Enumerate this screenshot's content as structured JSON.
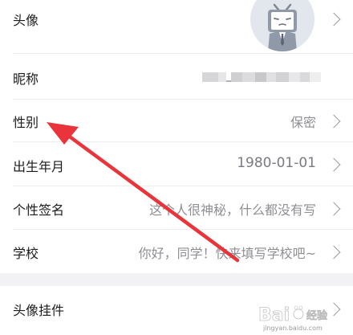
{
  "profile": {
    "avatar_label": "头像",
    "nickname_label": "昵称",
    "gender_label": "性别",
    "gender_value": "保密",
    "birthday_label": "出生年月",
    "birthday_value": "1980-01-01",
    "signature_label": "个性签名",
    "signature_value": "这个人很神秘，什么都没有写",
    "school_label": "学校",
    "school_value": "你好，同学！快来填写学校吧~",
    "pendant_label": "头像挂件"
  },
  "colors": {
    "annotation_arrow": "#e8343a",
    "background": "#f2f2f4",
    "value_text": "#8f8f94"
  },
  "icons": [
    "chevron-right-icon",
    "tv-mascot-avatar-icon",
    "annotation-arrow"
  ],
  "watermark": {
    "text": "Baidu 经验",
    "url": "jingyan.baidu.com"
  }
}
